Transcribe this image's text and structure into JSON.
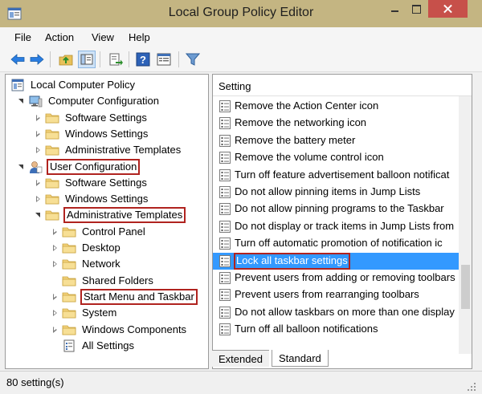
{
  "window": {
    "title": "Local Group Policy Editor"
  },
  "menu": [
    "File",
    "Action",
    "View",
    "Help"
  ],
  "toolbar": {
    "icons": [
      "back-arrow-icon",
      "forward-arrow-icon",
      "up-folder-icon",
      "show-hide-tree-icon",
      "export-list-icon",
      "help-icon",
      "properties-icon",
      "filter-icon"
    ]
  },
  "tree": [
    {
      "label": "Local Computer Policy",
      "depth": 0,
      "expander": "none",
      "icon": "policy-icon",
      "highlight": false
    },
    {
      "label": "Computer Configuration",
      "depth": 1,
      "expander": "open",
      "icon": "computer-icon",
      "highlight": false
    },
    {
      "label": "Software Settings",
      "depth": 2,
      "expander": "closed",
      "icon": "folder-icon",
      "highlight": false
    },
    {
      "label": "Windows Settings",
      "depth": 2,
      "expander": "closed",
      "icon": "folder-icon",
      "highlight": false
    },
    {
      "label": "Administrative Templates",
      "depth": 2,
      "expander": "closed",
      "icon": "folder-icon",
      "highlight": false
    },
    {
      "label": "User Configuration",
      "depth": 1,
      "expander": "open",
      "icon": "user-icon",
      "highlight": true
    },
    {
      "label": "Software Settings",
      "depth": 2,
      "expander": "closed",
      "icon": "folder-icon",
      "highlight": false
    },
    {
      "label": "Windows Settings",
      "depth": 2,
      "expander": "closed",
      "icon": "folder-icon",
      "highlight": false
    },
    {
      "label": "Administrative Templates",
      "depth": 2,
      "expander": "open",
      "icon": "folder-icon",
      "highlight": true
    },
    {
      "label": "Control Panel",
      "depth": 3,
      "expander": "closed",
      "icon": "folder-icon",
      "highlight": false
    },
    {
      "label": "Desktop",
      "depth": 3,
      "expander": "closed",
      "icon": "folder-icon",
      "highlight": false
    },
    {
      "label": "Network",
      "depth": 3,
      "expander": "closed",
      "icon": "folder-icon",
      "highlight": false
    },
    {
      "label": "Shared Folders",
      "depth": 3,
      "expander": "none",
      "icon": "folder-icon",
      "highlight": false
    },
    {
      "label": "Start Menu and Taskbar",
      "depth": 3,
      "expander": "closed",
      "icon": "folder-icon",
      "highlight": true
    },
    {
      "label": "System",
      "depth": 3,
      "expander": "closed",
      "icon": "folder-icon",
      "highlight": false
    },
    {
      "label": "Windows Components",
      "depth": 3,
      "expander": "closed",
      "icon": "folder-icon",
      "highlight": false
    },
    {
      "label": "All Settings",
      "depth": 3,
      "expander": "none",
      "icon": "all-settings-icon",
      "highlight": false
    }
  ],
  "list": {
    "column_header": "Setting",
    "items": [
      {
        "label": "Remove the Action Center icon",
        "selected": false
      },
      {
        "label": "Remove the networking icon",
        "selected": false
      },
      {
        "label": "Remove the battery meter",
        "selected": false
      },
      {
        "label": "Remove the volume control icon",
        "selected": false
      },
      {
        "label": "Turn off feature advertisement balloon notificat",
        "selected": false
      },
      {
        "label": "Do not allow pinning items in Jump Lists",
        "selected": false
      },
      {
        "label": "Do not allow pinning programs to the Taskbar",
        "selected": false
      },
      {
        "label": "Do not display or track items in Jump Lists from",
        "selected": false
      },
      {
        "label": "Turn off automatic promotion of notification ic",
        "selected": false
      },
      {
        "label": "Lock all taskbar settings",
        "selected": true
      },
      {
        "label": "Prevent users from adding or removing toolbars",
        "selected": false
      },
      {
        "label": "Prevent users from rearranging toolbars",
        "selected": false
      },
      {
        "label": "Do not allow taskbars on more than one display",
        "selected": false
      },
      {
        "label": "Turn off all balloon notifications",
        "selected": false
      }
    ]
  },
  "tabs": {
    "extended": "Extended",
    "standard": "Standard"
  },
  "status": {
    "text": "80 setting(s)"
  },
  "colors": {
    "titlebar": "#c4b582",
    "selection": "#3399ff",
    "highlight_box": "#b0231f",
    "close_button": "#c7504a"
  }
}
